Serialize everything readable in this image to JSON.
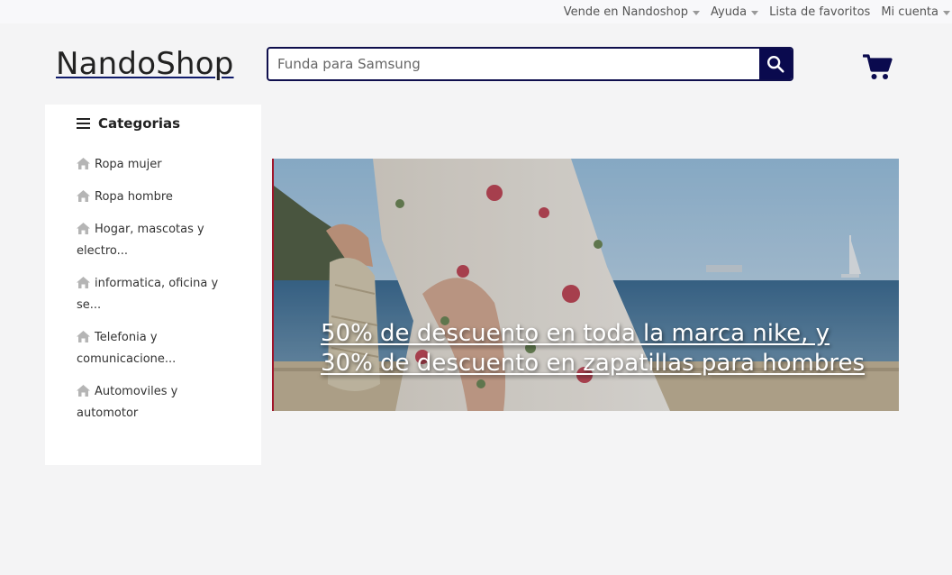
{
  "topbar": {
    "items": [
      {
        "label": "Vende en Nandoshop",
        "dropdown": true
      },
      {
        "label": "Ayuda",
        "dropdown": true
      },
      {
        "label": "Lista de favoritos",
        "dropdown": false
      },
      {
        "label": "Mi cuenta",
        "dropdown": true
      }
    ]
  },
  "header": {
    "logo": "NandoShop",
    "search": {
      "placeholder": "Funda para Samsung",
      "value": ""
    }
  },
  "sidebar": {
    "title": "Categorias",
    "items": [
      {
        "label": "Ropa mujer"
      },
      {
        "label": "Ropa hombre"
      },
      {
        "label": "Hogar, mascotas y electro..."
      },
      {
        "label": "informatica, oficina y se..."
      },
      {
        "label": "Telefonia y comunicacione..."
      },
      {
        "label": "Automoviles y automotor"
      }
    ]
  },
  "banner": {
    "text": "50% de descuento en toda la marca nike, y 30% de descuento en zapatillas para hombres"
  },
  "colors": {
    "accent": "#0a0a4e",
    "background": "#f4f4f5",
    "banner_border": "#a0142a"
  },
  "icons": {
    "search": "search-icon",
    "cart": "cart-icon",
    "menu": "menu-icon",
    "category": "home-icon"
  }
}
